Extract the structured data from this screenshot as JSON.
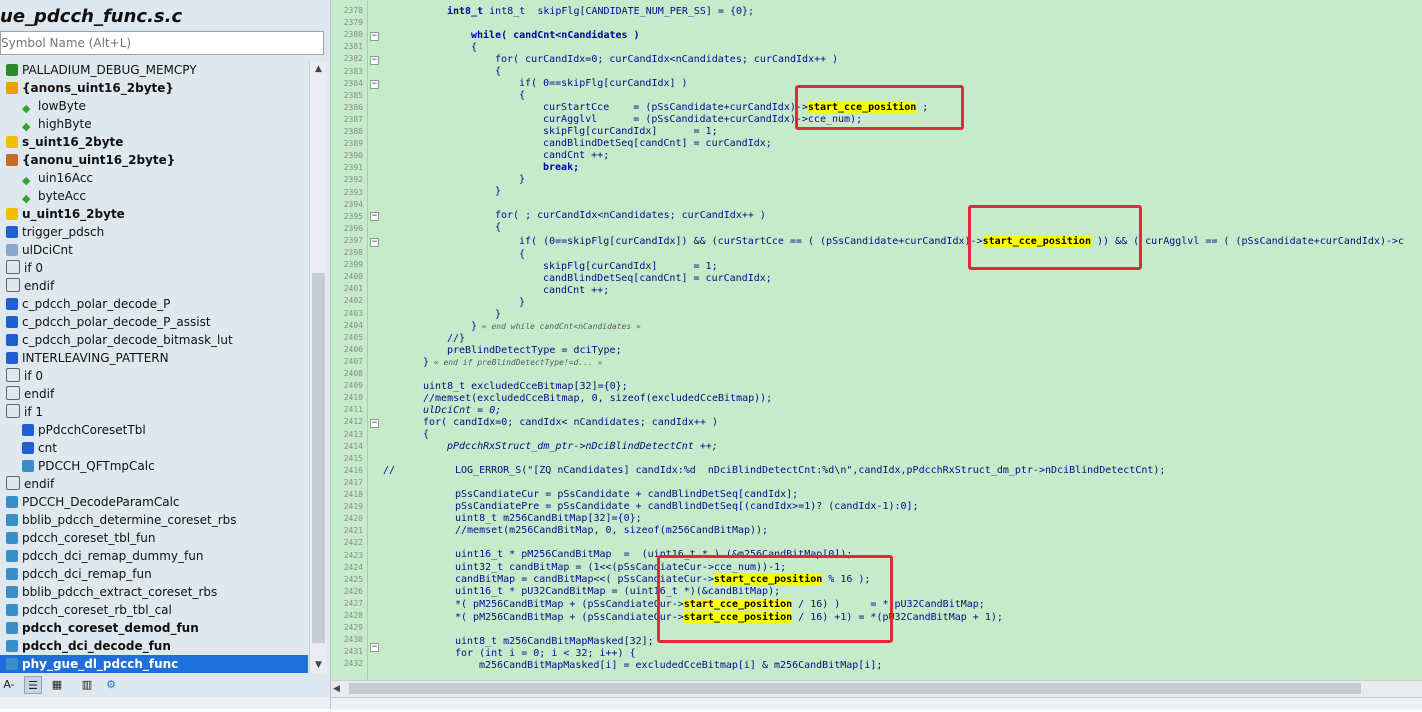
{
  "file_title": "ue_pdcch_func.s.c",
  "search": {
    "placeholder": "Symbol Name (Alt+L)"
  },
  "symbols": [
    {
      "label": "PALLADIUM_DEBUG_MEMCPY",
      "icon": "macro-icon",
      "indent": 0,
      "bold": false
    },
    {
      "label": "{anons_uint16_2byte}",
      "icon": "struct-icon",
      "indent": 0,
      "bold": true
    },
    {
      "label": "lowByte",
      "icon": "member-icon",
      "indent": 1,
      "bold": false
    },
    {
      "label": "highByte",
      "icon": "member-icon",
      "indent": 1,
      "bold": false
    },
    {
      "label": "s_uint16_2byte",
      "icon": "typedef-icon",
      "indent": 0,
      "bold": true
    },
    {
      "label": "{anonu_uint16_2byte}",
      "icon": "union-icon",
      "indent": 0,
      "bold": true
    },
    {
      "label": "uin16Acc",
      "icon": "member-icon",
      "indent": 1,
      "bold": false
    },
    {
      "label": "byteAcc",
      "icon": "member-icon",
      "indent": 1,
      "bold": false
    },
    {
      "label": "u_uint16_2byte",
      "icon": "typedef-icon",
      "indent": 0,
      "bold": true
    },
    {
      "label": "trigger_pdsch",
      "icon": "function-icon",
      "indent": 0,
      "bold": false
    },
    {
      "label": "ulDciCnt",
      "icon": "variable-icon",
      "indent": 0,
      "bold": false
    },
    {
      "label": "if 0",
      "icon": "condition-icon",
      "indent": 0,
      "bold": false
    },
    {
      "label": "endif",
      "icon": "condition-icon",
      "indent": 0,
      "bold": false
    },
    {
      "label": "c_pdcch_polar_decode_P",
      "icon": "function-icon",
      "indent": 0,
      "bold": false
    },
    {
      "label": "c_pdcch_polar_decode_P_assist",
      "icon": "function-icon",
      "indent": 0,
      "bold": false
    },
    {
      "label": "c_pdcch_polar_decode_bitmask_lut",
      "icon": "function-icon",
      "indent": 0,
      "bold": false
    },
    {
      "label": "INTERLEAVING_PATTERN",
      "icon": "function-icon",
      "indent": 0,
      "bold": false
    },
    {
      "label": "if 0",
      "icon": "condition-icon",
      "indent": 0,
      "bold": false
    },
    {
      "label": "endif",
      "icon": "condition-icon",
      "indent": 0,
      "bold": false
    },
    {
      "label": "if 1",
      "icon": "condition-icon",
      "indent": 0,
      "bold": false
    },
    {
      "label": "pPdcchCoresetTbl",
      "icon": "function-icon",
      "indent": 1,
      "bold": false
    },
    {
      "label": "cnt",
      "icon": "function-icon",
      "indent": 1,
      "bold": false
    },
    {
      "label": "PDCCH_QFTmpCalc",
      "icon": "file-icon",
      "indent": 1,
      "bold": false
    },
    {
      "label": "endif",
      "icon": "condition-icon",
      "indent": 0,
      "bold": false
    },
    {
      "label": "PDCCH_DecodeParamCalc",
      "icon": "file-icon",
      "indent": 0,
      "bold": false
    },
    {
      "label": "bblib_pdcch_determine_coreset_rbs",
      "icon": "file-icon",
      "indent": 0,
      "bold": false
    },
    {
      "label": "pdcch_coreset_tbl_fun",
      "icon": "file-icon",
      "indent": 0,
      "bold": false
    },
    {
      "label": "pdcch_dci_remap_dummy_fun",
      "icon": "file-icon",
      "indent": 0,
      "bold": false
    },
    {
      "label": "pdcch_dci_remap_fun",
      "icon": "file-icon",
      "indent": 0,
      "bold": false
    },
    {
      "label": "bblib_pdcch_extract_coreset_rbs",
      "icon": "file-icon",
      "indent": 0,
      "bold": false
    },
    {
      "label": "pdcch_coreset_rb_tbl_cal",
      "icon": "file-icon",
      "indent": 0,
      "bold": false
    },
    {
      "label": "pdcch_coreset_demod_fun",
      "icon": "file-icon",
      "indent": 0,
      "bold": true
    },
    {
      "label": "pdcch_dci_decode_fun",
      "icon": "file-icon",
      "indent": 0,
      "bold": true
    },
    {
      "label": "phy_gue_dl_pdcch_func",
      "icon": "file-icon",
      "indent": 0,
      "bold": true,
      "selected": true
    }
  ],
  "toolbar": {
    "az": "A-Z"
  },
  "line_numbers": [
    "2378",
    "2379",
    "2380",
    "2381",
    "2382",
    "2383",
    "2384",
    "2385",
    "2386",
    "2387",
    "2388",
    "2389",
    "2390",
    "2391",
    "2392",
    "2393",
    "2394",
    "2395",
    "2396",
    "2397",
    "2398",
    "2399",
    "2400",
    "2401",
    "2402",
    "2403",
    "2404",
    "2405",
    "2406",
    "2407",
    "2408",
    "2409",
    "2410",
    "2411",
    "2412",
    "2413",
    "2414",
    "2415",
    "2416",
    "2417",
    "2418",
    "2419",
    "2420",
    "2421",
    "2422",
    "2423",
    "2424",
    "2425",
    "2426",
    "2427",
    "2428",
    "2429",
    "2430",
    "2431",
    "2432"
  ],
  "code": {
    "l2378": "int8_t  skipFlg[CANDIDATE_NUM_PER_SS] = {0};",
    "l2380": "while( candCnt<nCandidates )",
    "l2381": "{",
    "l2382": "for( curCandIdx=0; curCandIdx<nCandidates; curCandIdx++ )",
    "l2383": "{",
    "l2384": "if( 0==skipFlg[curCandIdx] )",
    "l2385": "{",
    "l2386a": "curStartCce    = (pSsCandidate+curCandIdx)->",
    "l2386b": "start_cce_position",
    "l2386c": " ;",
    "l2387": "curAgglvl      = (pSsCandidate+curCandIdx)->cce_num);",
    "l2388": "skipFlg[curCandIdx]      = 1;",
    "l2389": "candBlindDetSeq[candCnt] = curCandIdx;",
    "l2390": "candCnt ++;",
    "l2391": "break;",
    "l2392": "}",
    "l2393": "}",
    "l2395": "for( ; curCandIdx<nCandidates; curCandIdx++ )",
    "l2396": "{",
    "l2397a": "if( (0==skipFlg[curCandIdx]) && (curStartCce == ( (pSsCandidate+curCandIdx)->",
    "l2397b": "start_cce_position",
    "l2397c": " )) && ( curAgglvl == ( (pSsCandidate+curCandIdx)->c",
    "l2398": "{",
    "l2399": "skipFlg[curCandIdx]      = 1;",
    "l2400": "candBlindDetSeq[candCnt] = curCandIdx;",
    "l2401": "candCnt ++;",
    "l2402": "}",
    "l2403": "}",
    "l2404a": "}",
    "l2404b": " « end while candCnt<nCandidates »",
    "l2405": "//}",
    "l2406": "preBlindDetectType = dciType;",
    "l2407a": "}",
    "l2407b": " « end if preBlindDetectType!=d... »",
    "l2409": "uint8_t excludedCceBitmap[32]={0};",
    "l2410": "//memset(excludedCceBitmap, 0, sizeof(excludedCceBitmap));",
    "l2411": "ulDciCnt = 0;",
    "l2412": "for( candIdx=0; candIdx< nCandidates; candIdx++ )",
    "l2413": "{",
    "l2414": "pPdcchRxStruct_dm_ptr->nDciBlindDetectCnt ++;",
    "l2416a": "//",
    "l2416b": "LOG_ERROR_S(\"[ZQ nCandidates] candIdx:%d  nDciBlindDetectCnt:%d\\n\",candIdx,pPdcchRxStruct_dm_ptr->nDciBlindDetectCnt);",
    "l2418": "pSsCandiateCur = pSsCandidate + candBlindDetSeq[candIdx];",
    "l2419": "pSsCandiatePre = pSsCandidate + candBlindDetSeq[(candIdx>=1)? (candIdx-1):0];",
    "l2420": "uint8_t m256CandBitMap[32]={0};",
    "l2421": "//memset(m256CandBitMap, 0, sizeof(m256CandBitMap));",
    "l2423": "uint16_t * pM256CandBitMap  =  (uint16_t * ) (&m256CandBitMap[0]);",
    "l2424": "uint32_t candBitMap = (1<<(pSsCandiateCur->cce_num))-1;",
    "l2425a": "candBitMap = candBitMap<<( pSsCandiateCur->",
    "l2425b": "start_cce_position",
    "l2425c": " % 16 );",
    "l2426": "uint16_t * pU32CandBitMap = (uint16_t *)(&candBitMap);",
    "l2427a": "*( pM256CandBitMap + (pSsCandiateCur->",
    "l2427b": "start_cce_position",
    "l2427c": " / 16) )     = * pU32CandBitMap;",
    "l2428a": "*( pM256CandBitMap + (pSsCandiateCur->",
    "l2428b": "start_cce_position",
    "l2428c": " / 16) +1) = *(pU32CandBitMap + 1);",
    "l2430": "uint8_t m256CandBitMapMasked[32];",
    "l2431": "for (int i = 0; i < 32; i++) {",
    "l2432": "m256CandBitMapMasked[i] = excludedCceBitmap[i] & m256CandBitMap[i];"
  },
  "colors": {
    "editor_bg": "#c5ebcb",
    "highlight": "#ffff00",
    "marker": "#e0293a",
    "selection": "#1e6fd9"
  }
}
